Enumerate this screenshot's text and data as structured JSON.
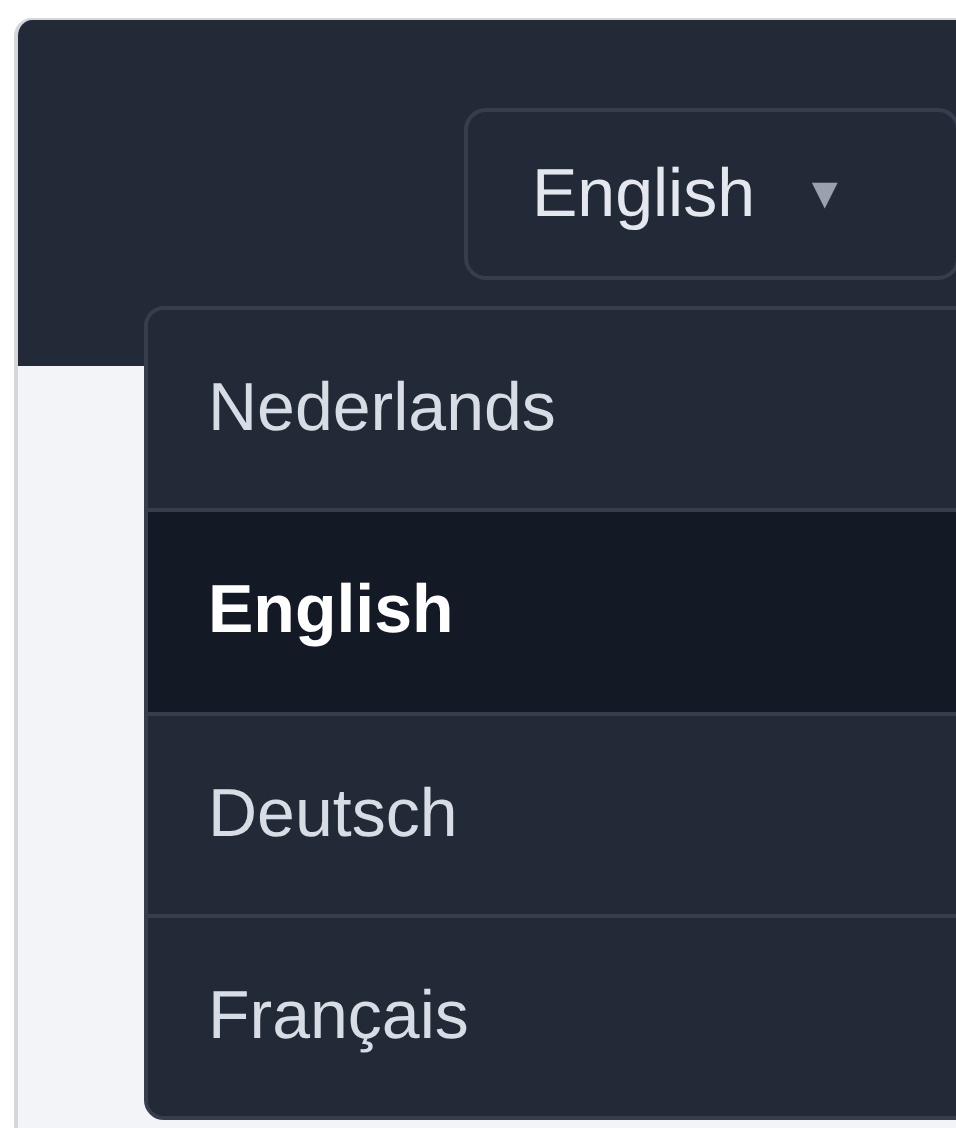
{
  "language_button": {
    "label": "English",
    "caret": "▼"
  },
  "language_menu": {
    "items": [
      {
        "label": "Nederlands",
        "selected": false
      },
      {
        "label": "English",
        "selected": true
      },
      {
        "label": "Deutsch",
        "selected": false
      },
      {
        "label": "Français",
        "selected": false
      }
    ]
  }
}
